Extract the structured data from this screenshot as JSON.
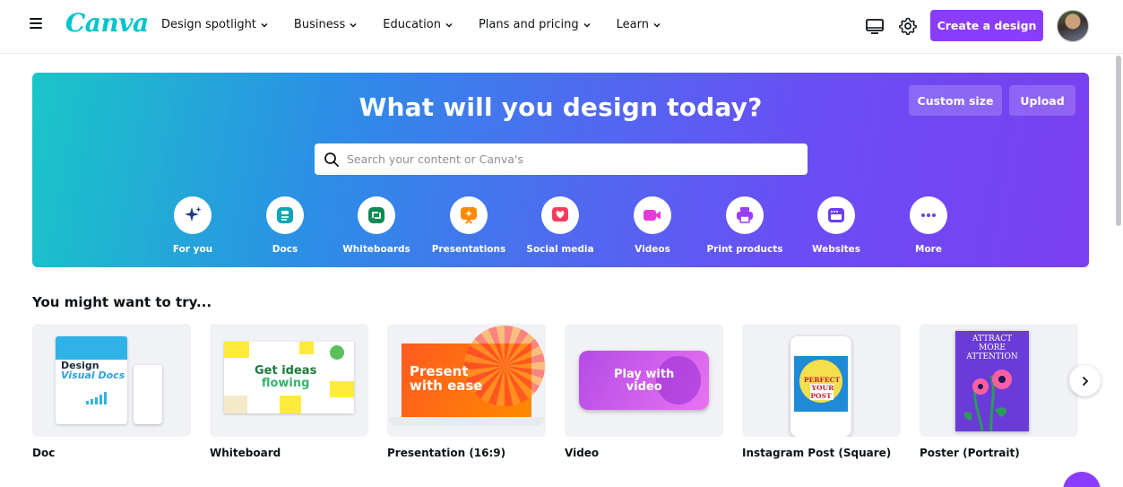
{
  "nav": {
    "logo": "Canva",
    "items": [
      {
        "label": "Design spotlight"
      },
      {
        "label": "Business"
      },
      {
        "label": "Education"
      },
      {
        "label": "Plans and pricing"
      },
      {
        "label": "Learn"
      }
    ],
    "create_label": "Create a design",
    "icons": [
      "menu-icon",
      "desktop-icon",
      "gear-icon",
      "chevron-down-icon"
    ]
  },
  "hero": {
    "title": "What will you design today?",
    "custom_size_label": "Custom size",
    "upload_label": "Upload",
    "search_placeholder": "Search your content or Canva's",
    "categories": [
      {
        "label": "For you",
        "icon": "sparkle-icon",
        "color": "#1e3a8a"
      },
      {
        "label": "Docs",
        "icon": "doc-icon",
        "color": "#13a3b5"
      },
      {
        "label": "Whiteboards",
        "icon": "whiteboard-icon",
        "color": "#0f8a55"
      },
      {
        "label": "Presentations",
        "icon": "presentation-icon",
        "color": "#ff8a00"
      },
      {
        "label": "Social media",
        "icon": "heart-icon",
        "color": "#ff3b5c"
      },
      {
        "label": "Videos",
        "icon": "video-icon",
        "color": "#e63bd8"
      },
      {
        "label": "Print products",
        "icon": "printer-icon",
        "color": "#9b3df0"
      },
      {
        "label": "Websites",
        "icon": "browser-icon",
        "color": "#6b3df0"
      },
      {
        "label": "More",
        "icon": "more-icon",
        "color": "#6b3df0"
      }
    ]
  },
  "section": {
    "title": "You might want to try...",
    "cards": [
      {
        "label": "Doc"
      },
      {
        "label": "Whiteboard"
      },
      {
        "label": "Presentation (16:9)"
      },
      {
        "label": "Video"
      },
      {
        "label": "Instagram Post (Square)"
      },
      {
        "label": "Poster (Portrait)"
      }
    ]
  },
  "thumbs": {
    "doc_line1": "Design",
    "doc_line2": "Visual Docs",
    "wb_line1": "Get ideas",
    "wb_line2": "flowing",
    "pres_line1": "Present",
    "pres_line2": "with ease",
    "vid_line1": "Play with",
    "vid_line2": "video",
    "ig_line1": "PERFECT",
    "ig_line2": "YOUR POST",
    "poster_line1": "ATTRACT",
    "poster_line2": "MORE",
    "poster_line3": "ATTENTION"
  },
  "colors": {
    "accent": "#8b3dff",
    "logo": "#00c4cc"
  }
}
